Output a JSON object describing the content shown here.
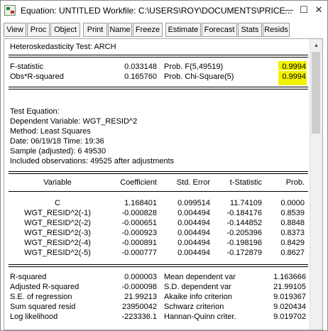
{
  "window": {
    "title": "Equation: UNTITLED   Workfile: C:\\USERS\\ROY\\DOCUMENTS\\PRICE...",
    "minimize": "—",
    "maximize": "☐",
    "close": "✕"
  },
  "toolbar": [
    "View",
    "Proc",
    "Object",
    "Print",
    "Name",
    "Freeze",
    "Estimate",
    "Forecast",
    "Stats",
    "Resids"
  ],
  "test": {
    "title": "Heteroskedasticity Test: ARCH",
    "rows": [
      {
        "label": "F-statistic",
        "value": "0.033148",
        "plabel": "Prob. F(5,49519)",
        "pvalue": "0.9994"
      },
      {
        "label": "Obs*R-squared",
        "value": "0.165760",
        "plabel": "Prob. Chi-Square(5)",
        "pvalue": "0.9994"
      }
    ],
    "highlight_color": "#f2f200"
  },
  "equation": {
    "lines": [
      "Test Equation:",
      "Dependent Variable: WGT_RESID^2",
      "Method: Least Squares",
      "Date: 06/19/18   Time: 19:36",
      "Sample (adjusted): 6 49530",
      "Included observations: 49525 after adjustments"
    ]
  },
  "coef_table": {
    "headers": [
      "Variable",
      "Coefficient",
      "Std. Error",
      "t-Statistic",
      "Prob."
    ],
    "rows": [
      [
        "C",
        "1.168401",
        "0.099514",
        "11.74109",
        "0.0000"
      ],
      [
        "WGT_RESID^2(-1)",
        "-0.000828",
        "0.004494",
        "-0.184176",
        "0.8539"
      ],
      [
        "WGT_RESID^2(-2)",
        "-0.000651",
        "0.004494",
        "-0.144852",
        "0.8848"
      ],
      [
        "WGT_RESID^2(-3)",
        "-0.000923",
        "0.004494",
        "-0.205396",
        "0.8373"
      ],
      [
        "WGT_RESID^2(-4)",
        "-0.000891",
        "0.004494",
        "-0.198196",
        "0.8429"
      ],
      [
        "WGT_RESID^2(-5)",
        "-0.000777",
        "0.004494",
        "-0.172879",
        "0.8627"
      ]
    ]
  },
  "stats": {
    "rows": [
      [
        "R-squared",
        "0.000003",
        "Mean dependent var",
        "1.163666"
      ],
      [
        "Adjusted R-squared",
        "-0.000098",
        "S.D. dependent var",
        "21.99105"
      ],
      [
        "S.E. of regression",
        "21.99213",
        "Akaike info criterion",
        "9.019367"
      ],
      [
        "Sum squared resid",
        "23950042",
        "Schwarz criterion",
        "9.020434"
      ],
      [
        "Log likelihood",
        "-223336.1",
        "Hannan-Quinn criter.",
        "9.019702"
      ]
    ]
  }
}
